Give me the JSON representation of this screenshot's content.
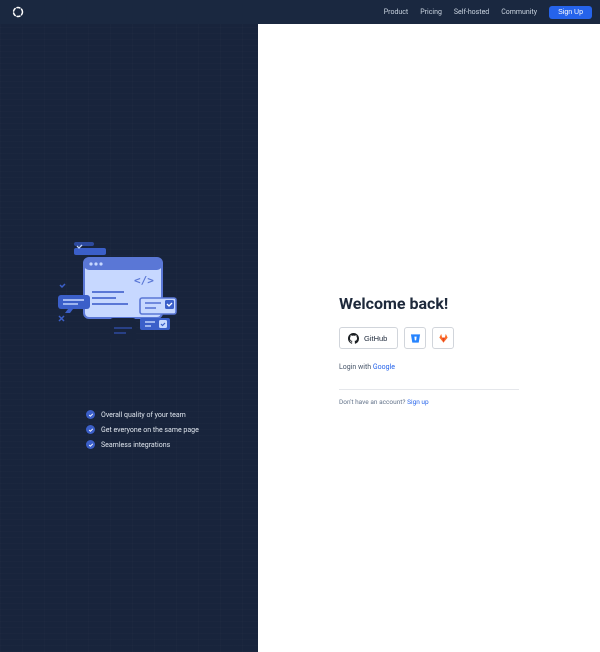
{
  "nav": {
    "product": "Product",
    "pricing": "Pricing",
    "self_hosted": "Self-hosted",
    "community": "Community",
    "signup": "Sign Up"
  },
  "features": {
    "f0": "Overall quality of your team",
    "f1": "Get everyone on the same page",
    "f2": "Seamless integrations"
  },
  "login": {
    "welcome": "Welcome back!",
    "github": "GitHub",
    "login_with": "Login with ",
    "google": "Google",
    "no_account": "Don't have an account? ",
    "signup": "Sign up"
  }
}
